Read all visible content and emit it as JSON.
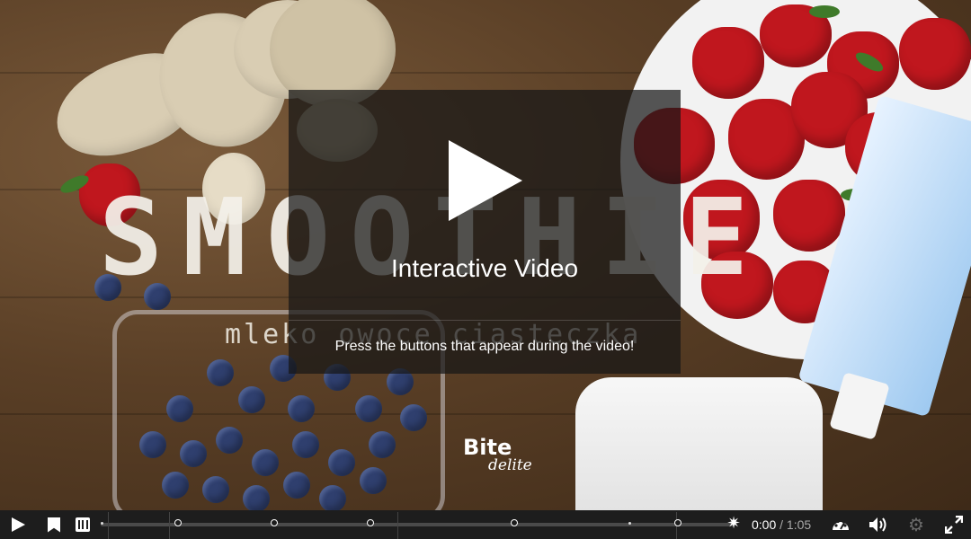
{
  "video": {
    "scene_title_overlay": "SMOOTHIE",
    "scene_subtitle_overlay": "mleko owoce ciasteczka",
    "logo_line1": "Bite",
    "logo_line2": "delite"
  },
  "dialog": {
    "title": "Interactive Video",
    "description": "Press the buttons that appear during the video!"
  },
  "controls": {
    "current_time": "0:00",
    "separator": "/",
    "duration": "1:05",
    "progress_fraction": 0,
    "interaction_markers_count": 6,
    "icons": [
      "play-icon",
      "bookmark-icon",
      "chapters-icon",
      "star-icon",
      "quality-icon",
      "volume-icon",
      "settings-icon",
      "fullscreen-icon"
    ]
  },
  "colors": {
    "controlbar_bg": "#1d1d1d",
    "dialog_bg": "rgba(22,22,22,0.72)",
    "text": "#ffffff"
  }
}
